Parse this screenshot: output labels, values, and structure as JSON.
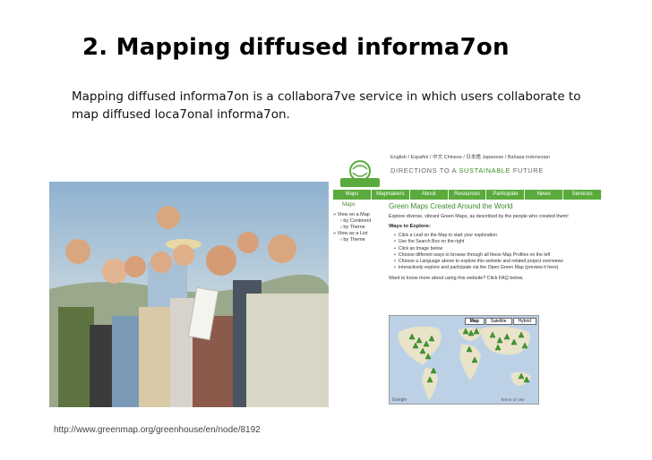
{
  "slide": {
    "title": "2. Mapping diffused informa7on",
    "description": "Mapping diffused informa7on is a collabora7ve service in which users collaborate to map diffused loca7onal informa7on.",
    "caption": "http://www.greenmap.org/greenhouse/en/node/8192"
  },
  "website": {
    "languages": "English / Español / 中文 Chinese / 日本語 Japanese / Bahasa Indonesian",
    "tagline_pre": "DIRECTIONS TO A ",
    "tagline_highlight": "SUSTAINABLE",
    "tagline_post": " FUTURE",
    "logo_text": "GREEN MAP",
    "nav": [
      "Maps",
      "Mapmakers",
      "About",
      "Resources",
      "Participate",
      "News",
      "Services"
    ],
    "sidebar": {
      "heading": "Maps",
      "items": [
        "» View on a Map",
        "› by Continent",
        "› by Theme",
        "» View as a List",
        "› by Theme"
      ]
    },
    "main": {
      "heading": "Green Maps Created Around the World",
      "intro": "Explore diverse, vibrant Green Maps, as described by the people who created them!",
      "ways_label": "Ways to Explore:",
      "ways": [
        "Click a Leaf on the Map to start your exploration",
        "Use the Search Box on the right",
        "Click an Image below",
        "Choose different ways to browse through all these Map Profiles on the left",
        "Choose a Language above to explore this website and related project overviews",
        "Interactively explore and participate via the Open Green Map (preview it here)."
      ],
      "faq": "Want to know more about using this website? Click FAQ below."
    },
    "map": {
      "tabs": [
        "Map",
        "Satellite",
        "Hybrid"
      ],
      "active_tab": "Map",
      "footer_left": "Google",
      "footer_right": "Terms of Use"
    }
  },
  "colors": {
    "green_brand": "#5aaa3c",
    "green_text": "#3a8a2a",
    "map_water": "#bcd1e6",
    "map_land": "#e9e3c9"
  }
}
